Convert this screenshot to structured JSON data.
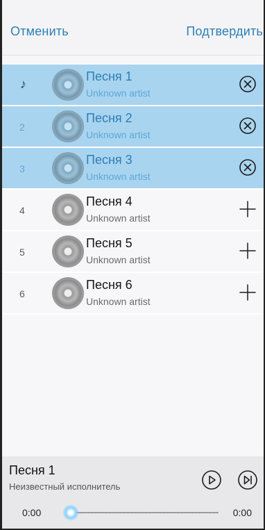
{
  "header": {
    "cancel_label": "Отменить",
    "confirm_label": "Подтвердить"
  },
  "songs": [
    {
      "number": "",
      "playing": true,
      "title": "Песня 1",
      "artist": "Unknown artist",
      "selected": true,
      "action": "remove-circle-icon"
    },
    {
      "number": "2",
      "playing": false,
      "title": "Песня 2",
      "artist": "Unknown artist",
      "selected": true,
      "action": "remove-circle-icon"
    },
    {
      "number": "3",
      "playing": false,
      "title": "Песня 3",
      "artist": "Unknown artist",
      "selected": true,
      "action": "remove-circle-icon"
    },
    {
      "number": "4",
      "playing": false,
      "title": "Песня 4",
      "artist": "Unknown artist",
      "selected": false,
      "action": "add-icon"
    },
    {
      "number": "5",
      "playing": false,
      "title": "Песня 5",
      "artist": "Unknown artist",
      "selected": false,
      "action": "add-icon"
    },
    {
      "number": "6",
      "playing": false,
      "title": "Песня 6",
      "artist": "Unknown artist",
      "selected": false,
      "action": "add-icon"
    }
  ],
  "player": {
    "title": "Песня 1",
    "artist": "Неизвестный исполнитель",
    "time_current": "0:00",
    "time_total": "0:00",
    "progress": 0
  },
  "colors": {
    "accent": "#2d7fb6",
    "selected_row": "#a9d4ef",
    "player_bg": "#e8e8ea"
  }
}
